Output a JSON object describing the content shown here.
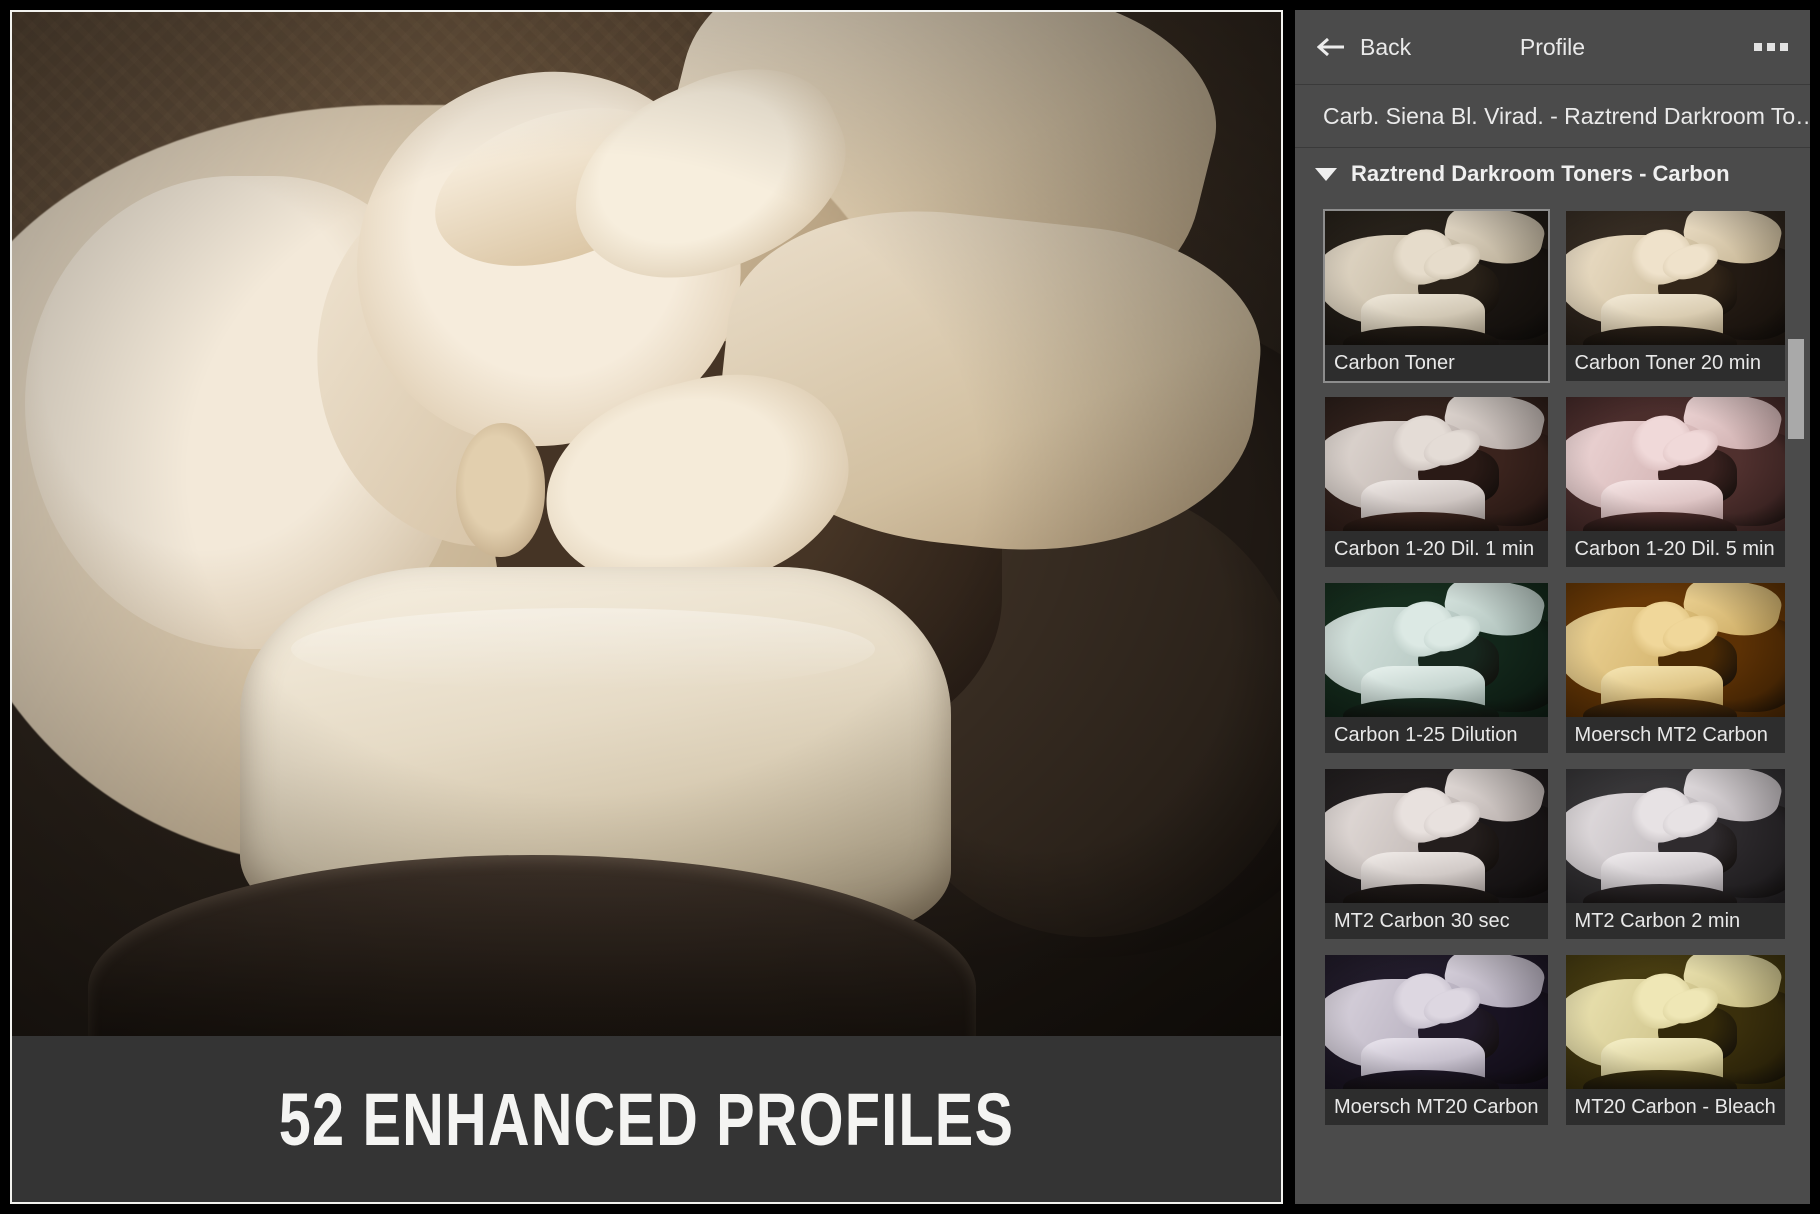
{
  "banner": {
    "text": "52 ENHANCED PROFILES"
  },
  "panel": {
    "back_label": "Back",
    "title": "Profile",
    "more_label": "…",
    "preset_name": "Carb. Siena Bl. Virad. - Raztrend Darkroom To…",
    "group_header": "Raztrend Darkroom Toners - Carbon",
    "group_expanded": true,
    "colors": {
      "panel_bg": "#4b4b4b",
      "label_bg": "#2d2d2d",
      "text": "#e9e9e9",
      "selected_border": "#8d8d8d",
      "scrollbar_thumb": "#a9a9a9",
      "banner_bg": "#343434",
      "frame_border": "#f2f2ee"
    },
    "profiles": [
      {
        "label": "Carbon Toner",
        "selected": true,
        "tint": {
          "bg": "#2a241c",
          "couch": "#1a1511",
          "skin": "#e6dccb",
          "skin2": "#b7ab94",
          "hair": "#2a2219",
          "towel": "#efe8da",
          "rim": "#241d16"
        }
      },
      {
        "label": "Carbon Toner  20 min",
        "selected": false,
        "tint": {
          "bg": "#3a3026",
          "couch": "#231a13",
          "skin": "#efe2cb",
          "skin2": "#c4b391",
          "hair": "#332619",
          "towel": "#f3ead7",
          "rim": "#2b2118"
        }
      },
      {
        "label": "Carbon  1-20 Dil.  1 min",
        "selected": false,
        "tint": {
          "bg": "#2f211c",
          "couch": "#3a231d",
          "skin": "#e4dcd6",
          "skin2": "#b3a8a4",
          "hair": "#2a1a16",
          "towel": "#efe9e6",
          "rim": "#3b241d"
        }
      },
      {
        "label": "Carbon  1-20 Dil.  5 min",
        "selected": false,
        "tint": {
          "bg": "#4a2d2c",
          "couch": "#50302e",
          "skin": "#f0d9d9",
          "skin2": "#cbaaaa",
          "hair": "#3a2220",
          "towel": "#f6e6e6",
          "rim": "#4a2b29"
        }
      },
      {
        "label": "Carbon  1-25 Dilution",
        "selected": false,
        "tint": {
          "bg": "#17301f",
          "couch": "#12261a",
          "skin": "#dce9e4",
          "skin2": "#a9bcb6",
          "hair": "#17271e",
          "towel": "#e8f2ee",
          "rim": "#15281d"
        }
      },
      {
        "label": "Moersch MT2 Carbon",
        "selected": false,
        "tint": {
          "bg": "#6b3a06",
          "couch": "#5c3105",
          "skin": "#f0d79a",
          "skin2": "#caa85f",
          "hair": "#4a2a05",
          "towel": "#f6e6b4",
          "rim": "#53300a"
        }
      },
      {
        "label": "MT2 Carbon 30 sec",
        "selected": false,
        "tint": {
          "bg": "#262223",
          "couch": "#1b1718",
          "skin": "#e8e1de",
          "skin2": "#b5aca9",
          "hair": "#241e1d",
          "towel": "#f1ece9",
          "rim": "#221c1b"
        }
      },
      {
        "label": "MT2 Carbon 2 min",
        "selected": false,
        "tint": {
          "bg": "#3b3a3c",
          "couch": "#2b282b",
          "skin": "#e7e2e4",
          "skin2": "#b4aeb2",
          "hair": "#2f2b2e",
          "towel": "#f0ecee",
          "rim": "#2e292c"
        }
      },
      {
        "label": "Moersch MT20 Carbon",
        "selected": false,
        "tint": {
          "bg": "#231d2c",
          "couch": "#191322",
          "skin": "#ddd7e1",
          "skin2": "#aaa3b3",
          "hair": "#211a29",
          "towel": "#eae5ee",
          "rim": "#1d1726"
        }
      },
      {
        "label": "MT20 Carbon - Bleach",
        "selected": false,
        "tint": {
          "bg": "#4a3f12",
          "couch": "#3a2f0c",
          "skin": "#efe7b6",
          "skin2": "#c5b97f",
          "hair": "#342a0a",
          "towel": "#f6f0c8",
          "rim": "#362c0d"
        }
      }
    ],
    "scrollbar": {
      "thumb_top_pct": 14,
      "thumb_height_pct": 10
    }
  }
}
